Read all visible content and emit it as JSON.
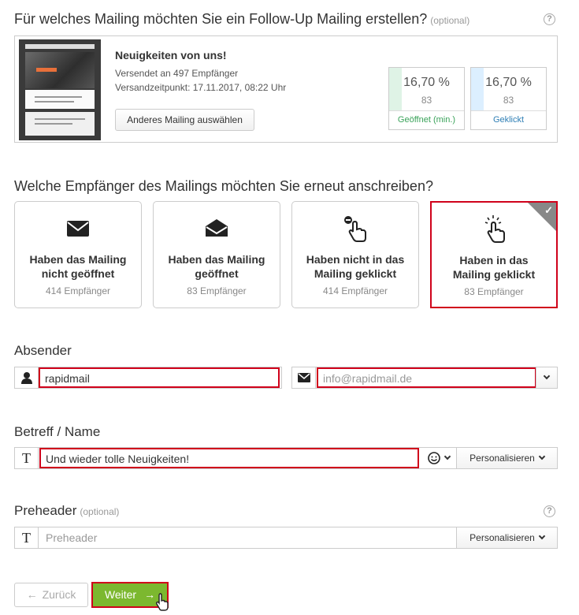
{
  "section1": {
    "title": "Für welches Mailing möchten Sie ein Follow-Up Mailing erstellen?",
    "optional": "(optional)",
    "help": "?"
  },
  "mailing": {
    "title": "Neuigkeiten von uns!",
    "sent_to": "Versendet an 497 Empfänger",
    "sent_at": "Versandzeitpunkt: 17.11.2017, 08:22 Uhr",
    "change_button": "Anderes Mailing auswählen",
    "thumbnail_headline": "Aurum sed & Mattis velit",
    "stats": [
      {
        "percent": "16,70 %",
        "count": "83",
        "label": "Geöffnet (min.)",
        "label_color": "#3aa35a",
        "bar_color": "#dff3e6"
      },
      {
        "percent": "16,70 %",
        "count": "83",
        "label": "Geklickt",
        "label_color": "#2f7fb5",
        "bar_color": "#dcefff"
      }
    ]
  },
  "section2": {
    "title": "Welche Empfänger des Mailings möchten Sie erneut anschreiben?",
    "options": [
      {
        "line1": "Haben das Mailing",
        "line2": "nicht geöffnet",
        "recipients": "414 Empfänger",
        "icon": "envelope-closed-icon"
      },
      {
        "line1": "Haben das Mailing",
        "line2": "geöffnet",
        "recipients": "83 Empfänger",
        "icon": "envelope-open-icon"
      },
      {
        "line1": "Haben nicht in das",
        "line2": "Mailing geklickt",
        "recipients": "414 Empfänger",
        "icon": "no-click-icon"
      },
      {
        "line1": "Haben in das",
        "line2": "Mailing geklickt",
        "recipients": "83 Empfänger",
        "icon": "click-icon",
        "selected": true
      }
    ]
  },
  "sender": {
    "label": "Absender",
    "name_value": "rapidmail",
    "email_placeholder": "info@rapidmail.de"
  },
  "subject": {
    "label": "Betreff / Name",
    "value": "Und wieder tolle Neuigkeiten!",
    "personalize": "Personalisieren"
  },
  "preheader": {
    "label": "Preheader",
    "optional": "(optional)",
    "placeholder": "Preheader",
    "personalize": "Personalisieren"
  },
  "nav": {
    "back": "Zurück",
    "next": "Weiter"
  },
  "colors": {
    "accent": "#7cb82f",
    "highlight": "#d0021b"
  }
}
